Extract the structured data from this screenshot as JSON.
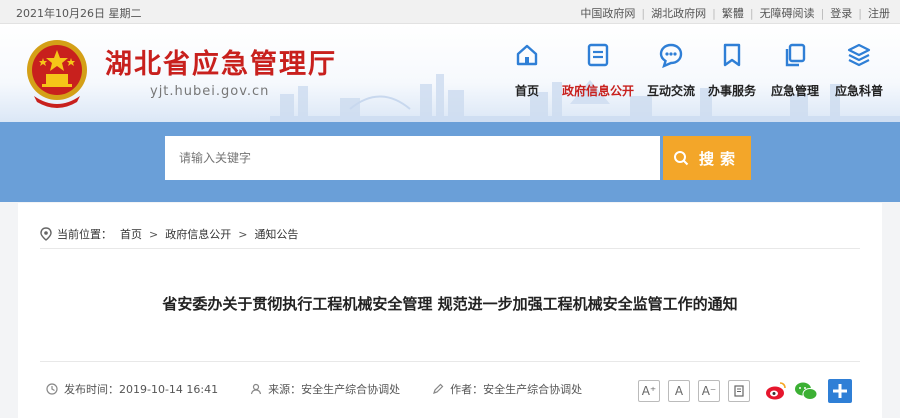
{
  "topbar": {
    "date": "2021年10月26日 星期二",
    "links": [
      "中国政府网",
      "湖北政府网",
      "繁體",
      "无障碍阅读",
      "登录",
      "注册"
    ]
  },
  "header": {
    "title": "湖北省应急管理厅",
    "domain": "yjt.hubei.gov.cn",
    "nav": [
      {
        "label": "首页",
        "icon": "home-icon"
      },
      {
        "label": "政府信息公开",
        "icon": "document-list-icon",
        "active": true
      },
      {
        "label": "互动交流",
        "icon": "chat-bubble-icon"
      },
      {
        "label": "办事服务",
        "icon": "bookmark-icon"
      },
      {
        "label": "应急管理",
        "icon": "copy-icon"
      },
      {
        "label": "应急科普",
        "icon": "layers-icon"
      }
    ]
  },
  "search": {
    "placeholder": "请输入关键字",
    "button_label": "搜索"
  },
  "breadcrumb": {
    "prefix": "当前位置：",
    "items": [
      "首页",
      "政府信息公开",
      "通知公告"
    ]
  },
  "article": {
    "title": "省安委办关于贯彻执行工程机械安全管理 规范进一步加强工程机械安全监管工作的通知",
    "publish_time": "发布时间：2019-10-14 16:41",
    "source": "来源：安全生产综合协调处",
    "author": "作者：安全生产综合协调处"
  },
  "tools": {
    "font_large": "A⁺",
    "font_medium": "A",
    "font_small": "A⁻"
  },
  "colors": {
    "brand_red": "#c8201d",
    "nav_blue": "#2f7fd6",
    "band_blue": "#6a9fd8",
    "search_orange": "#f3a629"
  }
}
